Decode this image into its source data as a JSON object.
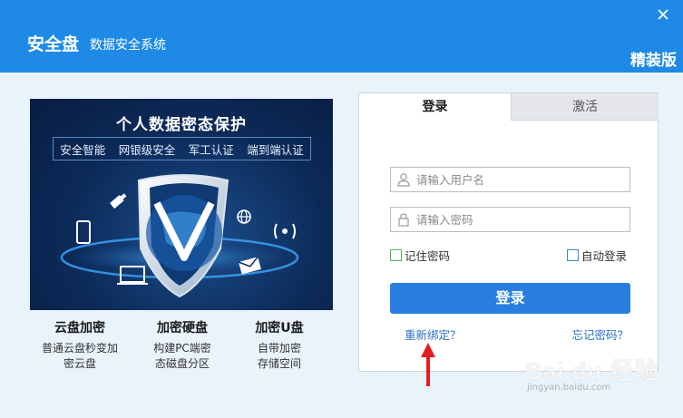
{
  "window": {
    "app_name": "安全盘",
    "subtitle": "数据安全系统",
    "edition": "精装版"
  },
  "banner": {
    "title": "个人数据密态保护",
    "tags": [
      "安全智能",
      "网银级安全",
      "军工认证",
      "端到端认证"
    ]
  },
  "features": [
    {
      "title": "云盘加密",
      "desc1": "普通云盘秒变加",
      "desc2": "密云盘"
    },
    {
      "title": "加密硬盘",
      "desc1": "构建PC端密",
      "desc2": "态磁盘分区"
    },
    {
      "title": "加密U盘",
      "desc1": "自带加密",
      "desc2": "存储空间"
    }
  ],
  "login": {
    "tabs": {
      "login": "登录",
      "activate": "激活"
    },
    "username_placeholder": "请输入用户名",
    "password_placeholder": "请输入密码",
    "remember_password": "记住密码",
    "auto_login": "自动登录",
    "submit": "登录",
    "rebind": "重新绑定？",
    "forgot_password": "忘记密码？"
  },
  "watermark": {
    "text": "Bai du 经验",
    "url": "jingyan.baidu.com"
  },
  "colors": {
    "titlebar": "#1e8ae6",
    "primary_button": "#2a7ee0",
    "link": "#2a6fc4",
    "annotation_arrow": "#e02020"
  }
}
